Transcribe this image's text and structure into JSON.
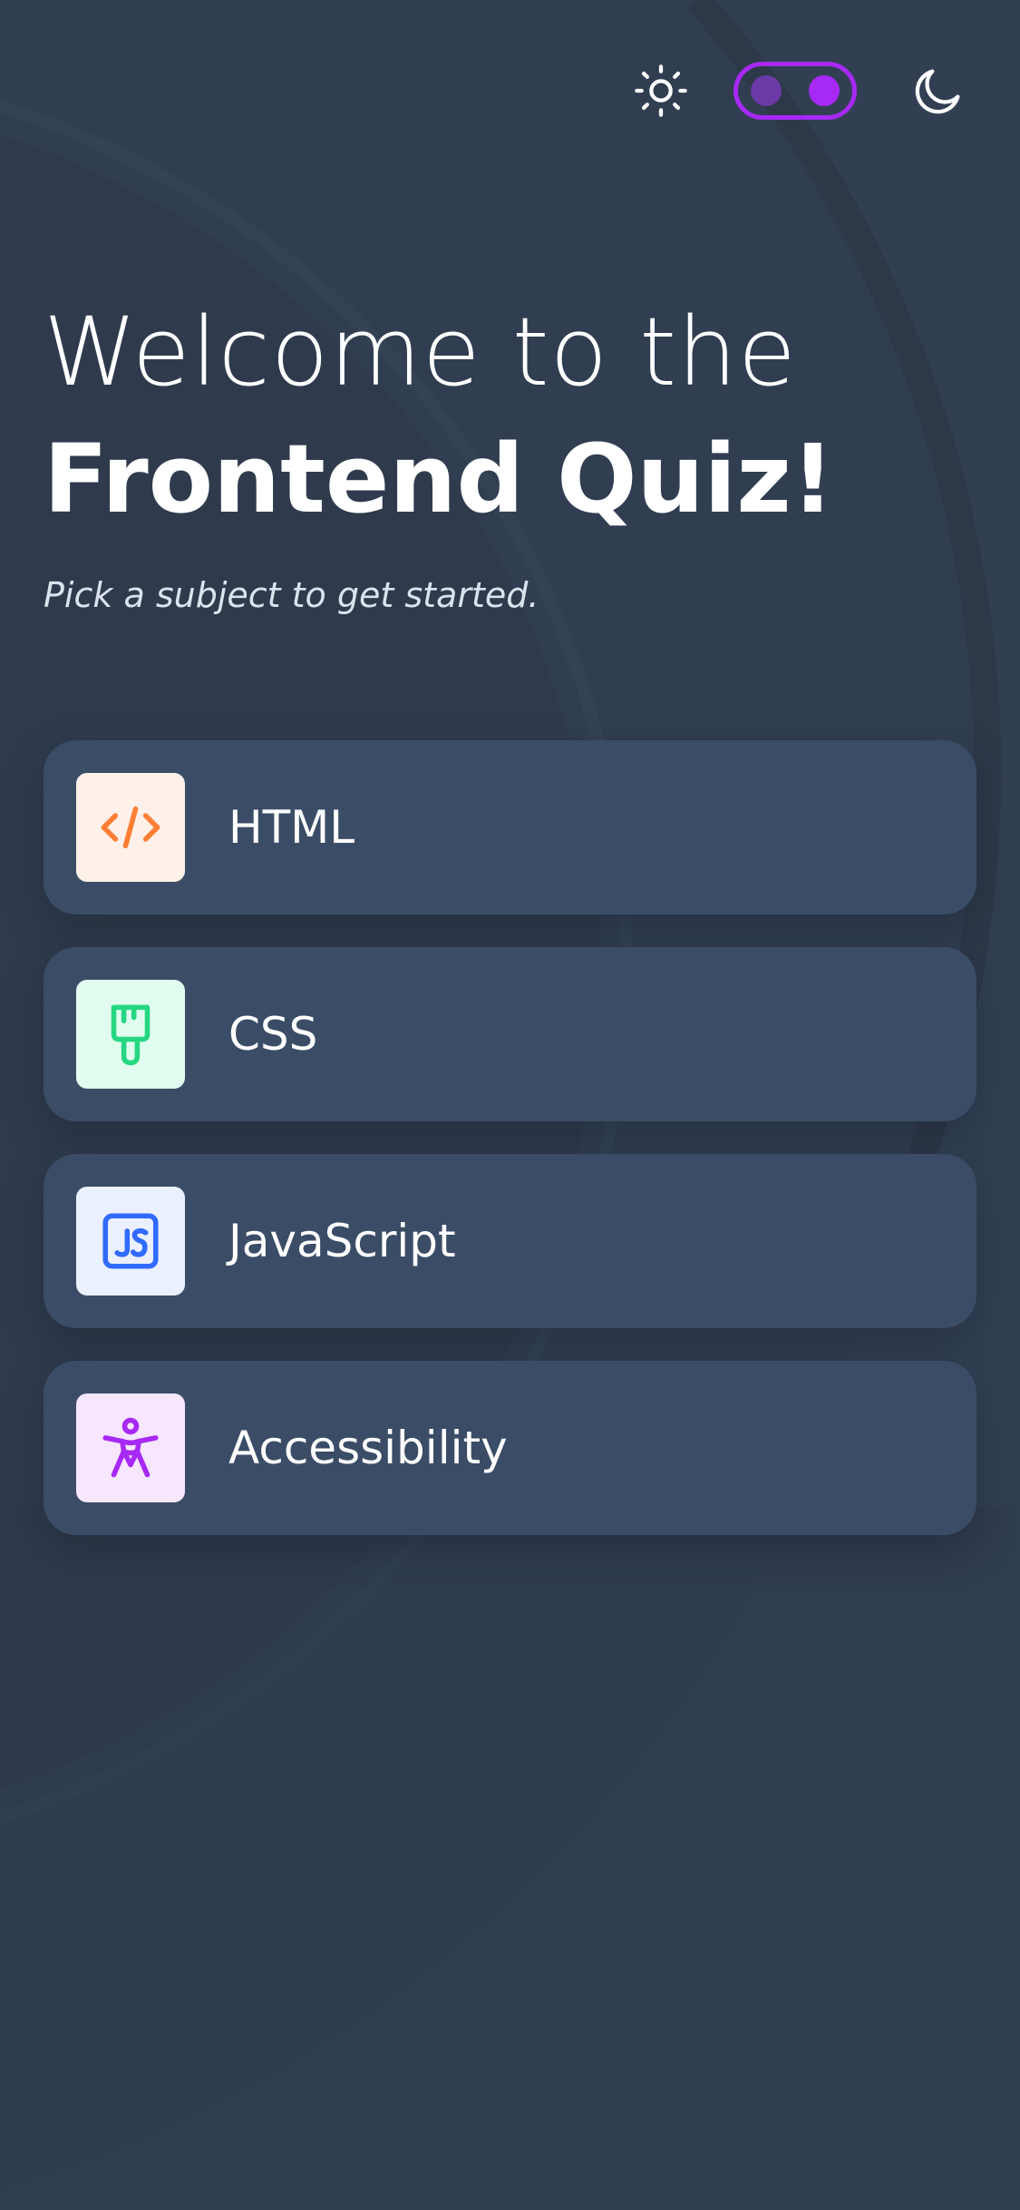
{
  "theme": {
    "background": "#313e51",
    "card": "#3b4d66",
    "accent": "#a729f5"
  },
  "header": {
    "light_icon": "sun-icon",
    "dark_icon": "moon-icon",
    "toggle_state": "dark"
  },
  "intro": {
    "title_light": "Welcome to the",
    "title_bold": "Frontend Quiz!",
    "subtitle": "Pick a subject to get started."
  },
  "subjects": [
    {
      "label": "HTML",
      "icon": "code-icon",
      "icon_bg": "#fff1e9",
      "icon_color": "#ff7e35"
    },
    {
      "label": "CSS",
      "icon": "paintbrush-icon",
      "icon_bg": "#e0fdef",
      "icon_color": "#26d782"
    },
    {
      "label": "JavaScript",
      "icon": "js-icon",
      "icon_bg": "#ebf0ff",
      "icon_color": "#306aff"
    },
    {
      "label": "Accessibility",
      "icon": "accessibility-icon",
      "icon_bg": "#f6e7ff",
      "icon_color": "#a729f5"
    }
  ]
}
